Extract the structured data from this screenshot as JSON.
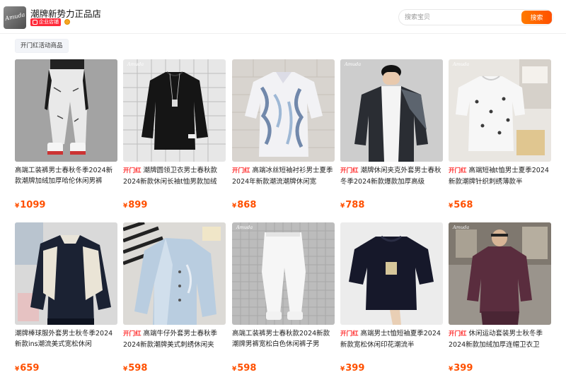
{
  "shop": {
    "name": "潮牌新势力正品店",
    "badge": "企业店铺",
    "logo_text": "Amuda"
  },
  "search": {
    "placeholder": "搜索宝贝",
    "button_label": "搜索"
  },
  "section_tag": "开门红活动商品",
  "currency": "¥",
  "promo_label": "开门红",
  "watermark": "Amuda",
  "products": [
    {
      "promo": false,
      "title": "高端工装裤男士春秋冬季2024新款潮牌加绒加厚哈伦休闲男裤",
      "price": "1099"
    },
    {
      "promo": true,
      "title": "潮牌圆领卫衣男士春秋款2024新款休闲长袖t恤男款加绒",
      "price": "899"
    },
    {
      "promo": true,
      "title": "高端冰丝短袖衬衫男士夏季2024年新款潮流潮牌休闲宽",
      "price": "868"
    },
    {
      "promo": true,
      "title": "潮牌休闲夹克外套男士春秋冬季2024新款爆款加厚高级",
      "price": "788"
    },
    {
      "promo": true,
      "title": "高端短袖t恤男士夏季2024新款潮牌针织刺绣薄款半",
      "price": "568"
    },
    {
      "promo": false,
      "title": "潮牌棒球服外套男士秋冬季2024新款ins潮流美式宽松休闲",
      "price": "659"
    },
    {
      "promo": true,
      "title": "高端牛仔外套男士春秋季2024新款潮牌美式刺绣休闲夹",
      "price": "598"
    },
    {
      "promo": false,
      "title": "高端工装裤男士春秋款2024新款潮牌男裤宽松白色休闲裤子男",
      "price": "598"
    },
    {
      "promo": true,
      "title": "高端男士t恤短袖夏季2024新款宽松休闲印花潮流半",
      "price": "399"
    },
    {
      "promo": true,
      "title": "休闲运动套装男士秋冬季2024新款加绒加厚连帽卫衣卫",
      "price": "399"
    }
  ]
}
